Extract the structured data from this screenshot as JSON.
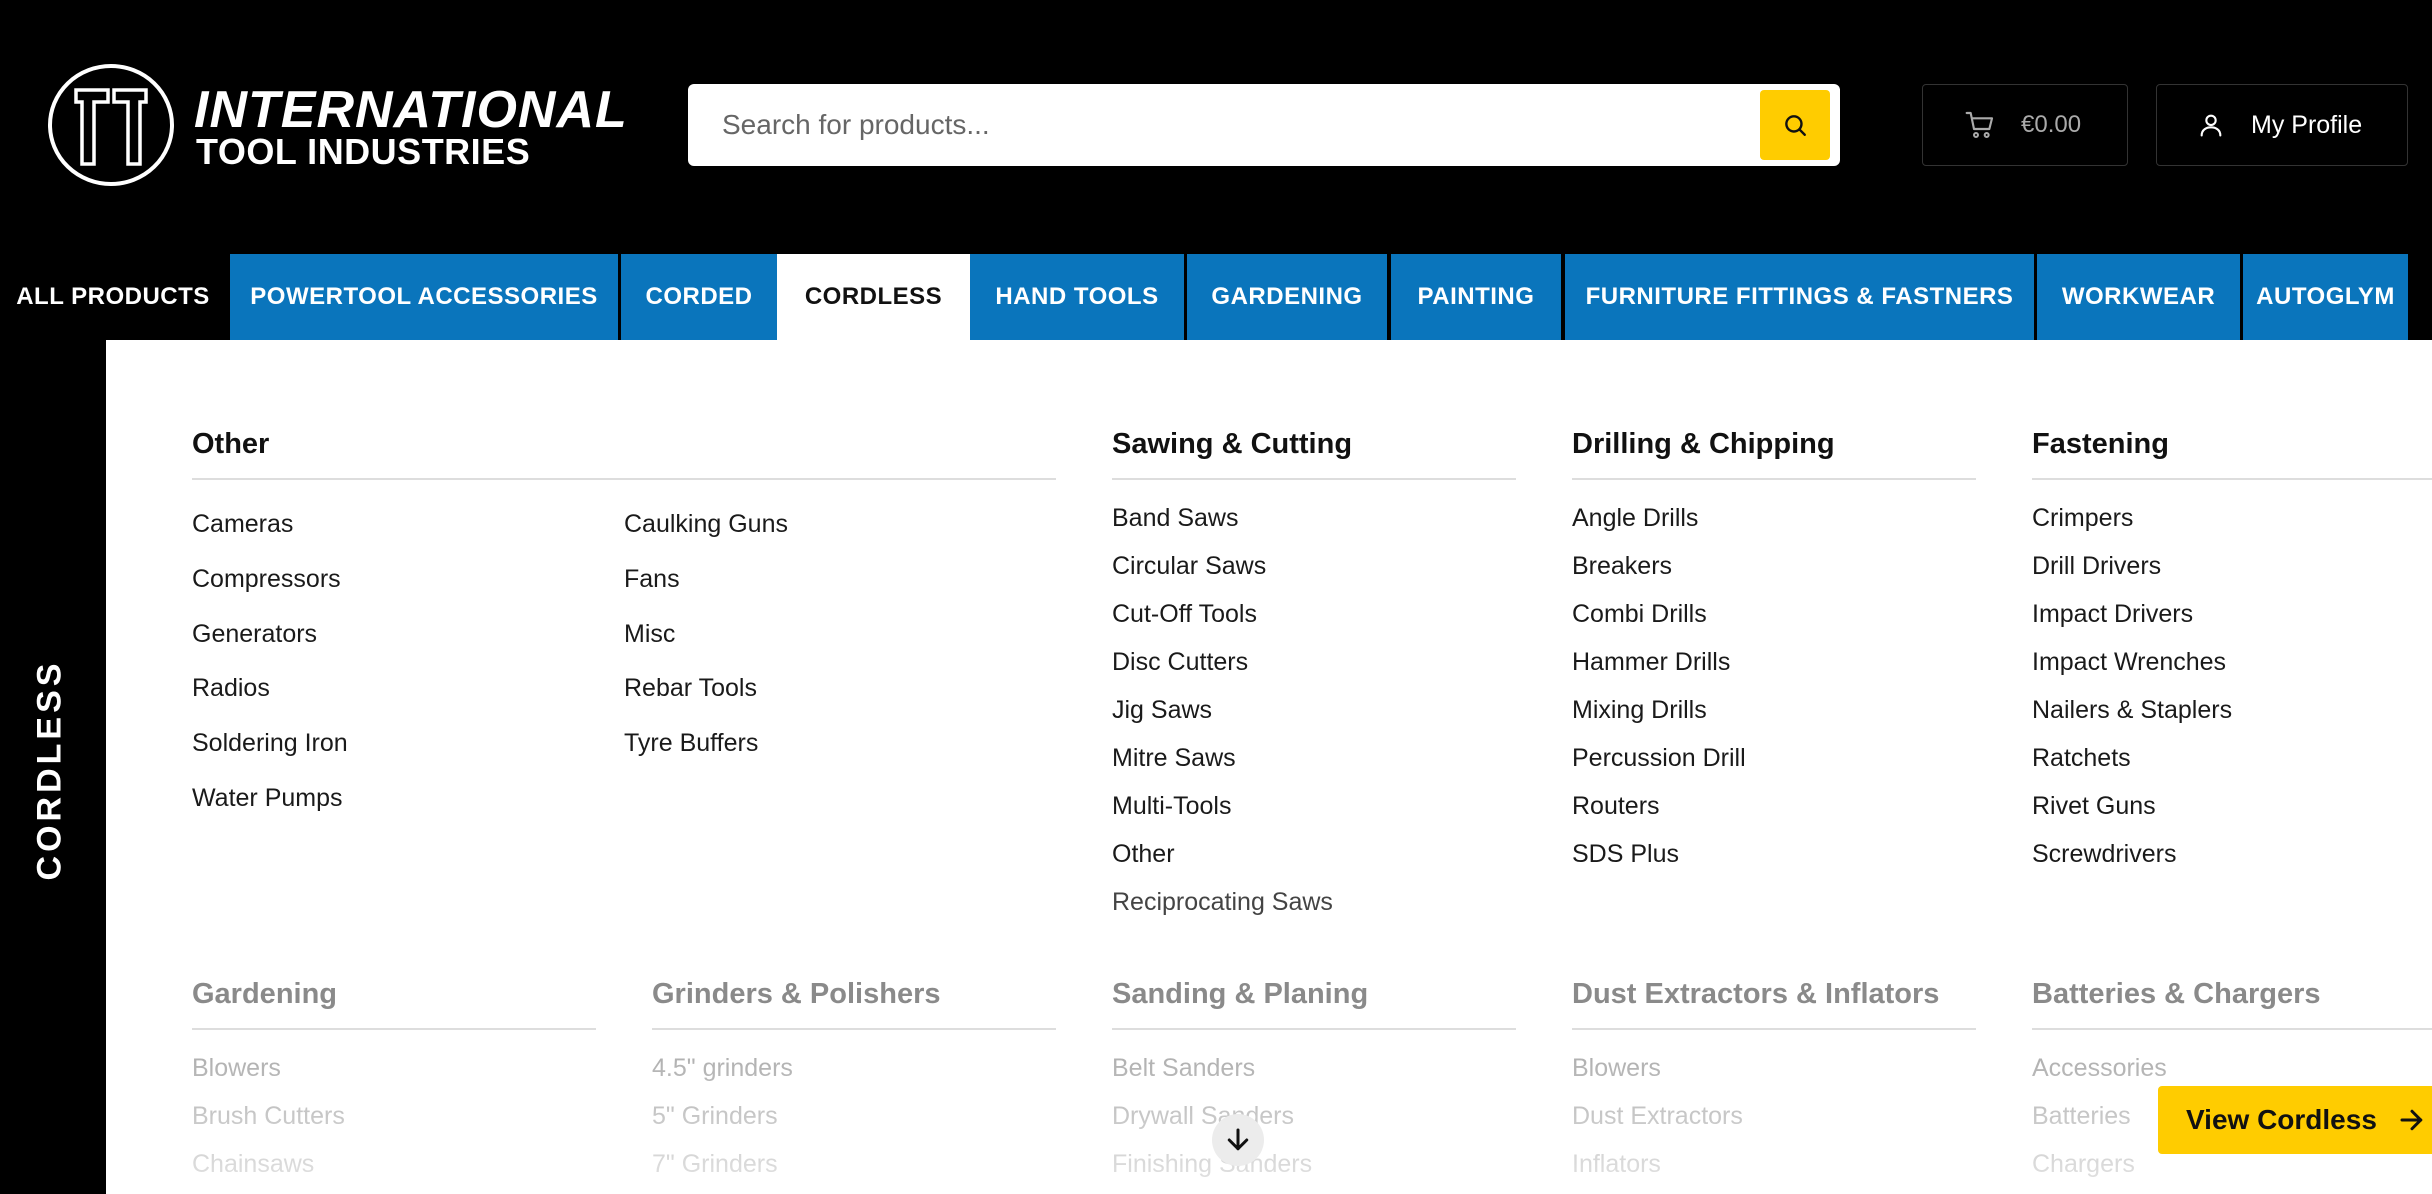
{
  "header": {
    "brand_line1": "INTERNATIONAL",
    "brand_line2": "TOOL INDUSTRIES",
    "search_placeholder": "Search for products...",
    "cart_total": "€0.00",
    "profile_label": "My Profile"
  },
  "nav": {
    "tabs": [
      {
        "label": "ALL PRODUCTS"
      },
      {
        "label": "POWERTOOL ACCESSORIES"
      },
      {
        "label": "CORDED"
      },
      {
        "label": "CORDLESS"
      },
      {
        "label": "HAND TOOLS"
      },
      {
        "label": "GARDENING"
      },
      {
        "label": "PAINTING"
      },
      {
        "label": "FURNITURE FITTINGS & FASTNERS"
      },
      {
        "label": "WORKWEAR"
      },
      {
        "label": "AUTOGLYM"
      }
    ]
  },
  "side_label": "CORDLESS",
  "menu": {
    "other": {
      "title": "Other",
      "col1": [
        "Cameras",
        "Compressors",
        "Generators",
        "Radios",
        "Soldering Iron",
        "Water Pumps"
      ],
      "col2": [
        "Caulking Guns",
        "Fans",
        "Misc",
        "Rebar Tools",
        "Tyre Buffers"
      ]
    },
    "sawing": {
      "title": "Sawing & Cutting",
      "items": [
        "Band Saws",
        "Circular Saws",
        "Cut-Off Tools",
        "Disc Cutters",
        "Jig Saws",
        "Mitre Saws",
        "Multi-Tools",
        "Other",
        "Reciprocating Saws"
      ]
    },
    "drilling": {
      "title": "Drilling & Chipping",
      "items": [
        "Angle Drills",
        "Breakers",
        "Combi Drills",
        "Hammer Drills",
        "Mixing Drills",
        "Percussion Drill",
        "Routers",
        "SDS Plus"
      ]
    },
    "fastening": {
      "title": "Fastening",
      "items": [
        "Crimpers",
        "Drill Drivers",
        "Impact Drivers",
        "Impact Wrenches",
        "Nailers & Staplers",
        "Ratchets",
        "Rivet Guns",
        "Screwdrivers"
      ]
    },
    "gardening": {
      "title": "Gardening",
      "items": [
        "Blowers",
        "Brush Cutters",
        "Chainsaws"
      ]
    },
    "grinders": {
      "title": "Grinders & Polishers",
      "items": [
        "4.5\" grinders",
        "5\" Grinders",
        "7\" Grinders"
      ]
    },
    "sanding": {
      "title": "Sanding & Planing",
      "items": [
        "Belt Sanders",
        "Drywall Sanders",
        "Finishing Sanders"
      ]
    },
    "dust": {
      "title": "Dust Extractors & Inflators",
      "items": [
        "Blowers",
        "Dust Extractors",
        "Inflators"
      ]
    },
    "batteries": {
      "title": "Batteries & Chargers",
      "items": [
        "Accessories",
        "Batteries",
        "Chargers"
      ]
    }
  },
  "view_button": "View Cordless",
  "colors": {
    "nav_blue": "#0a75bc",
    "accent_yellow": "#ffcc00"
  }
}
